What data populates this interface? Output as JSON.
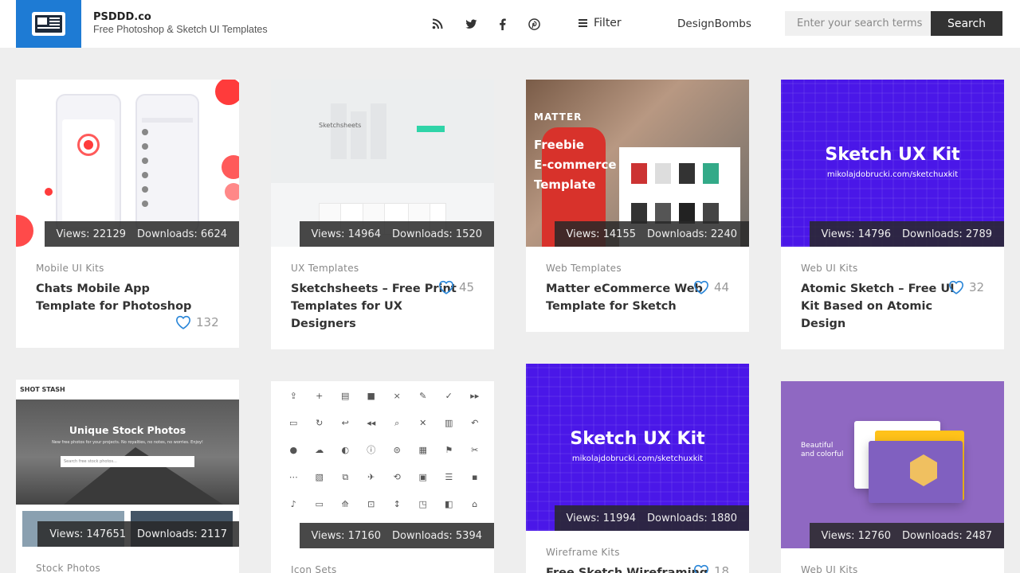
{
  "header": {
    "brand_title": "PSDDD.co",
    "brand_sub": "Free Photoshop & Sketch UI Templates",
    "filter_label": "Filter",
    "designbombs_label": "DesignBombs",
    "search_placeholder": "Enter your search terms",
    "search_button": "Search",
    "social_icons": [
      "rss-icon",
      "twitter-icon",
      "facebook-icon",
      "pinterest-icon"
    ]
  },
  "colors": {
    "brand_blue": "#1e7bd4",
    "kit_violet": "#4a17e8",
    "accent_red": "#ff3b3b",
    "web_purple": "#8f68c2"
  },
  "cards": [
    {
      "category": "Mobile UI Kits",
      "title_lines": [
        "Chats Mobile App",
        "Template for Photoshop"
      ],
      "likes": "132",
      "views": "Views: 22129",
      "downloads": "Downloads: 6624"
    },
    {
      "category": "UX Templates",
      "title_lines": [
        "Sketchsheets – Free Print",
        "Templates for UX",
        "Designers"
      ],
      "likes": "45",
      "views": "Views: 14964",
      "downloads": "Downloads: 1520",
      "thumb_text": "Sketchsheets"
    },
    {
      "category": "Web Templates",
      "title_lines": [
        "Matter eCommerce Web",
        "Template for Sketch"
      ],
      "likes": "44",
      "views": "Views: 14155",
      "downloads": "Downloads: 2240",
      "thumb_brand": "MATTER",
      "thumb_lines": [
        "Freebie",
        "E-commerce",
        "Template"
      ]
    },
    {
      "category": "Web UI Kits",
      "title_lines": [
        "Atomic Sketch – Free UI",
        "Kit Based on Atomic",
        "Design"
      ],
      "likes": "32",
      "views": "Views: 14796",
      "downloads": "Downloads: 2789",
      "thumb_title": "Sketch UX Kit",
      "thumb_url": "mikolajdobrucki.com/sketchuxkit"
    },
    {
      "category": "Stock Photos",
      "views": "Views: 147651",
      "downloads": "Downloads: 2117",
      "thumb_brand": "SHOT STASH",
      "thumb_title": "Unique Stock Photos",
      "thumb_sub": "New free photos for your projects. No royalties, no notes, no worries. Enjoy!",
      "thumb_search": "Search free stock photos..."
    },
    {
      "category": "Icon Sets",
      "views": "Views: 17160",
      "downloads": "Downloads: 5394"
    },
    {
      "category": "Wireframe Kits",
      "title_lines": [
        "Free Sketch Wireframing"
      ],
      "likes": "18",
      "views": "Views: 11994",
      "downloads": "Downloads: 1880",
      "thumb_title": "Sketch UX Kit",
      "thumb_url": "mikolajdobrucki.com/sketchuxkit"
    },
    {
      "category": "Web UI Kits",
      "views": "Views: 12760",
      "downloads": "Downloads: 2487",
      "thumb_lines": [
        "Beautiful",
        "and colorful"
      ]
    }
  ]
}
